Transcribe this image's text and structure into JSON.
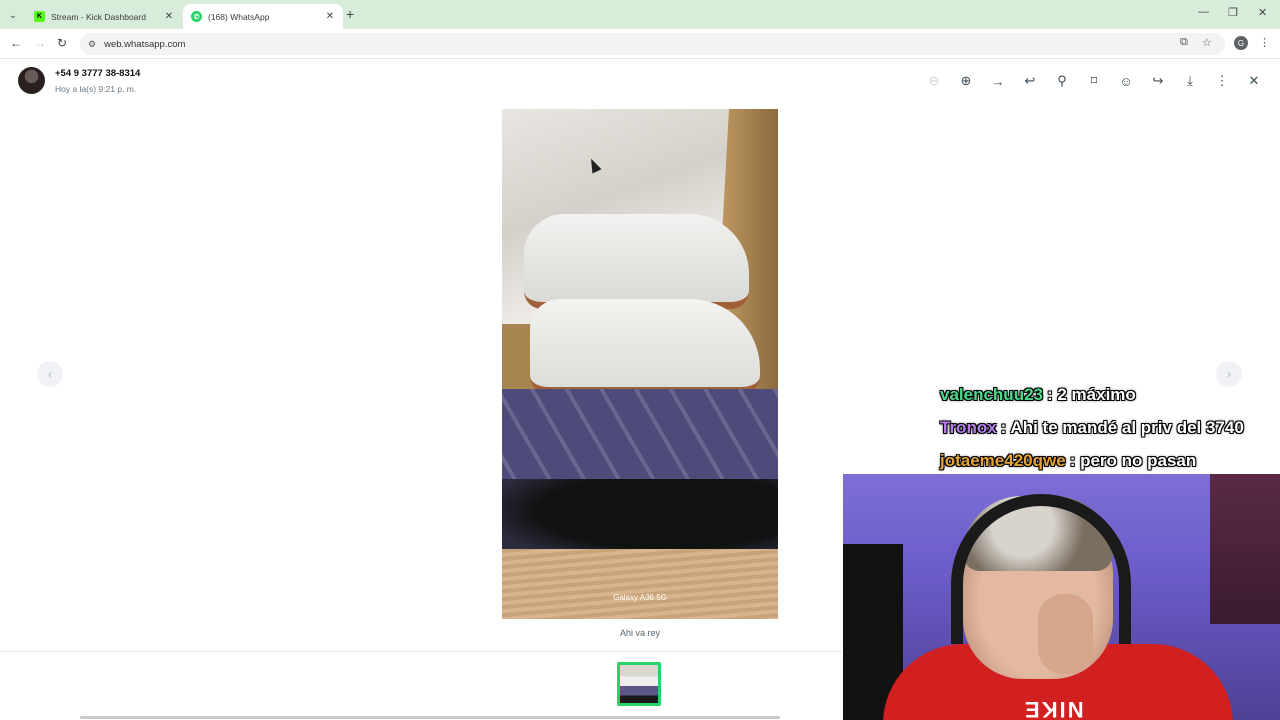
{
  "browser": {
    "tabs": [
      {
        "title": "Stream - Kick Dashboard",
        "favicon": "K"
      },
      {
        "title": "(168) WhatsApp",
        "favicon": ""
      }
    ],
    "url": "web.whatsapp.com",
    "profile_initial": "G"
  },
  "viewer": {
    "contact_name": "+54 9 3777 38-8314",
    "timestamp": "Hoy a la(s) 9:21 p. m.",
    "photo_watermark": "Galaxy A36 5G",
    "caption": "Ahi va rey",
    "prev_arrow": "‹",
    "next_arrow": "›"
  },
  "stream_chat": [
    {
      "user": "valenchuu23",
      "message": ": 2 máximo",
      "color": "#4cd98a"
    },
    {
      "user": "Tronox",
      "message": ": Ahi te mandé al priv del 3740",
      "color": "#b57ee8"
    },
    {
      "user": "jotaeme420qwe",
      "message": ": pero no pasan",
      "color": "#e3a436"
    }
  ],
  "webcam": {
    "shirt_text": "NIKE"
  }
}
